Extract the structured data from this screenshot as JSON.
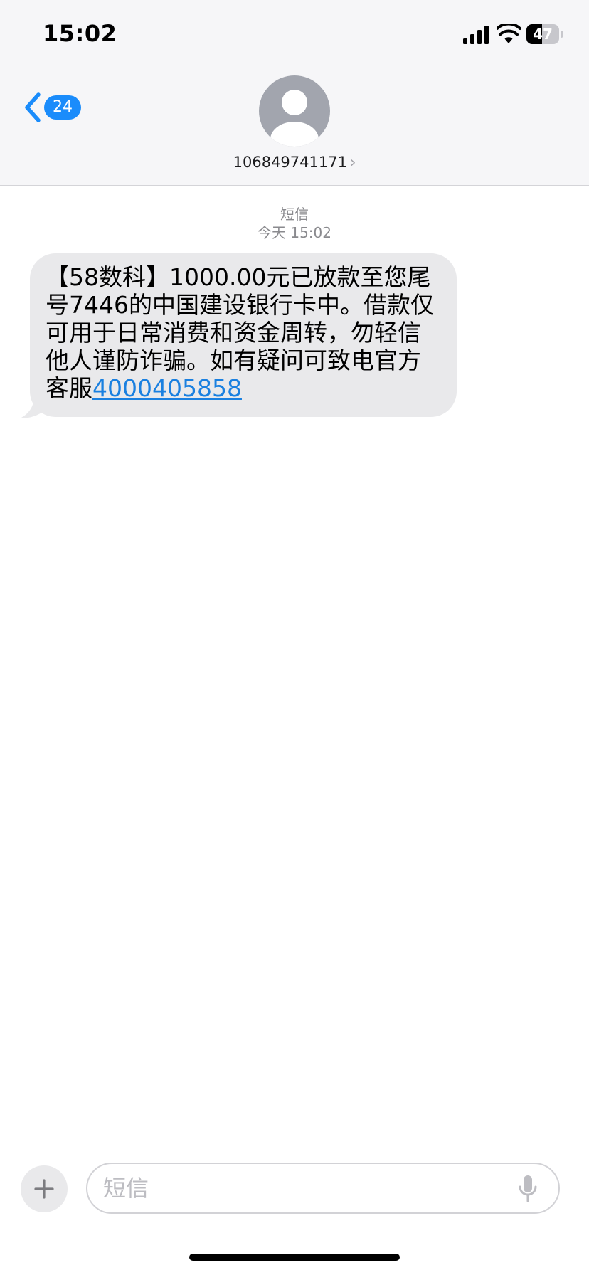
{
  "status_bar": {
    "time": "15:02",
    "battery": "47",
    "battery_level": 0.47
  },
  "header": {
    "back_badge": "24",
    "contact": "106849741171",
    "contact_chevron": "›"
  },
  "conversation": {
    "service_label": "短信",
    "timestamp": "今天 15:02",
    "message": {
      "text": "【58数科】1000.00元已放款至您尾号7446的中国建设银行卡中。借款仅可用于日常消费和资金周转，勿轻信他人谨防诈骗。如有疑问可致电官方客服",
      "phone_link": "4000405858"
    }
  },
  "composer": {
    "placeholder": "短信"
  },
  "icons": {
    "back": "chevron-left-icon",
    "avatar": "person-icon",
    "signal": "cellular-signal-icon",
    "wifi": "wifi-icon",
    "battery": "battery-icon",
    "plus": "plus-icon",
    "mic": "microphone-icon"
  },
  "colors": {
    "accent": "#1a8cfb",
    "bubble": "#e9e9eb",
    "header_bg": "#f6f6f8",
    "link": "#1a80e0"
  }
}
